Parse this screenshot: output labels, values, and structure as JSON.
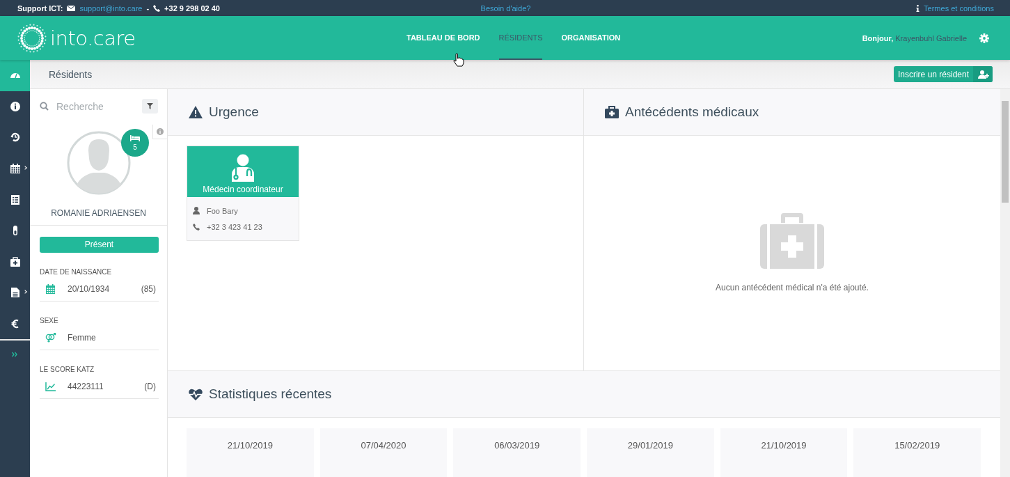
{
  "support_bar": {
    "label": "Support ICT:",
    "email": "support@into.care",
    "separator": "-",
    "phone": "+32 9 298 02 40",
    "help_link": "Besoin d'aide?",
    "terms_link": "Termes et conditions"
  },
  "header": {
    "logo_text": "into.care",
    "nav": [
      {
        "label": "TABLEAU DE BORD",
        "selected": false
      },
      {
        "label": "RÉSIDENTS",
        "selected": true
      },
      {
        "label": "ORGANISATION",
        "selected": false
      }
    ],
    "greeting": "Bonjour,",
    "user_name": "Krayenbuhl Gabrielle"
  },
  "rail": {
    "items": [
      {
        "selected": true,
        "has_submenu": false
      },
      {
        "selected": false,
        "has_submenu": false
      },
      {
        "selected": false,
        "has_submenu": false
      },
      {
        "selected": false,
        "has_submenu": true
      },
      {
        "selected": false,
        "has_submenu": false
      },
      {
        "selected": false,
        "has_submenu": false
      },
      {
        "selected": false,
        "has_submenu": false
      },
      {
        "selected": false,
        "has_submenu": true
      },
      {
        "selected": false,
        "has_submenu": false
      }
    ]
  },
  "breadcrumb": {
    "title": "Résidents",
    "action_button": "Inscrire un résident"
  },
  "resident": {
    "search_placeholder": "Recherche",
    "room": "5",
    "name": "ROMANIE ADRIAENSEN",
    "status": "Présent",
    "fields": [
      {
        "label": "DATE DE NAISSANCE",
        "value": "20/10/1934",
        "extra": "(85)"
      },
      {
        "label": "SEXE",
        "value": "Femme"
      },
      {
        "label": "LE SCORE KATZ",
        "value": "44223111",
        "extra": "(D)"
      }
    ]
  },
  "urgence": {
    "title": "Urgence",
    "contacts": [
      {
        "role": "Médecin coordinateur",
        "name": "Foo Bary",
        "phone": "+32 3 423 41 23"
      }
    ]
  },
  "antecedents": {
    "title": "Antécédents médicaux",
    "empty_message": "Aucun antécédent médical n'a été ajouté."
  },
  "statistics": {
    "title": "Statistiques récentes",
    "dates": [
      "21/10/2019",
      "07/04/2020",
      "06/03/2019",
      "29/01/2019",
      "21/10/2019",
      "15/02/2019"
    ]
  }
}
